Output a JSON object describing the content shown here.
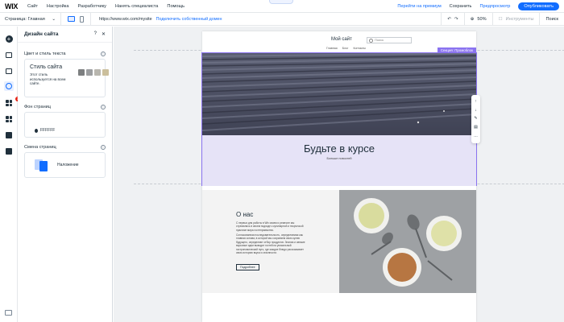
{
  "topbar": {
    "logo": "WIX",
    "menu": [
      "Сайт",
      "Настройка",
      "Разработчику",
      "Нанять специалиста",
      "Помощь"
    ],
    "upgrade_link": "Перейти на премиум",
    "save": "Сохранить",
    "preview": "Предпросмотр",
    "publish": "Опубликовать"
  },
  "toolbar": {
    "page_label": "Страница: Главная",
    "url": "https://www.wix.com/mysite",
    "connect_domain": "Подключить собственный домен",
    "zoom": "50%",
    "tools": "Инструменты",
    "search": "Поиск"
  },
  "rail": {
    "notification_count": "1"
  },
  "panel": {
    "title": "Дизайн сайта",
    "help": "?",
    "close": "✕",
    "section_theme": "Цвет и стиль текста",
    "theme_title": "Стиль сайта",
    "theme_desc": "Этот стиль используется на всем сайте.",
    "swatch_colors": [
      "#7d7f80",
      "#9c9ea0",
      "#b8b6ae",
      "#cbbf9c"
    ],
    "section_bg": "Фон страниц",
    "bg_hex": "FFFFFF",
    "section_transition": "Смена страниц",
    "transition_label": "Наложение"
  },
  "site": {
    "title": "Мой сайт",
    "search_placeholder": "Поиск",
    "nav": [
      "Главная",
      "Блог",
      "Контакты"
    ],
    "strip_tag": "Секция: Промоблок",
    "hero_heading": "Будьте в курсе",
    "hero_sub": "Больше новостей",
    "about_title": "О нас",
    "about_p1": "С первых дня работы в Wix своем и ремесле мы стремились в своем подходе к кулинарной и творческой практике мира гостеприимства.",
    "about_p2": "Согласованная последовательность, определяемая как главная основа, в которой мы сохраняем свою кухню будущего, определяют отбор продуктов. Знания и свежие вкусовые идеи выводят гостей на уникальный гастрономический путь, где каждое блюдо рассказывает свою историю вкуса и сезонности.",
    "about_btn": "Подробнее"
  },
  "float_toolbar": [
    "↑",
    "↓",
    "✎",
    "▤",
    "…"
  ]
}
